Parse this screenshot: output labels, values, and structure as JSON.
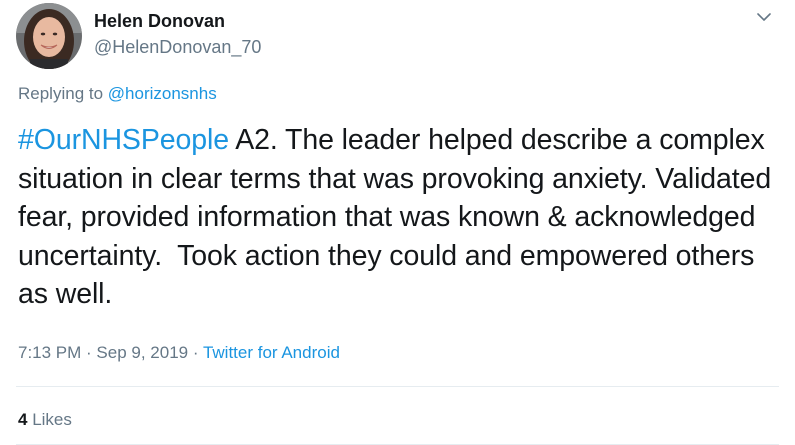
{
  "author": {
    "display_name": "Helen Donovan",
    "handle": "@HelenDonovan_70",
    "avatar_icon": "user-avatar"
  },
  "menu": {
    "icon": "chevron-down-icon"
  },
  "reply": {
    "prefix": "Replying to ",
    "mention": "@horizonsnhs"
  },
  "tweet": {
    "hashtag": "#OurNHSPeople",
    "body": " A2. The leader helped describe a complex situation in clear terms that was provoking anxiety. Validated fear, provided information that was known & acknowledged uncertainty.  Took action they could and empowered others as well."
  },
  "meta": {
    "time": "7:13 PM",
    "separator1": " · ",
    "date": "Sep 9, 2019",
    "separator2": " · ",
    "source": "Twitter for Android"
  },
  "stats": {
    "likes_count": "4",
    "likes_label": " Likes"
  },
  "colors": {
    "link": "#1b95e0",
    "secondary_text": "#657786",
    "primary_text": "#14171a",
    "divider": "#e6ecf0"
  }
}
